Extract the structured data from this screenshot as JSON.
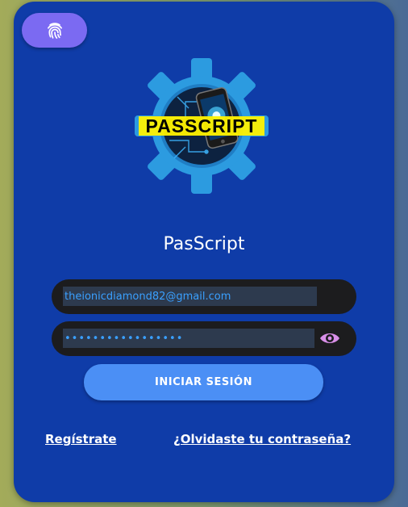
{
  "app": {
    "title": "PasScript",
    "logo_text": "PASSCRIPT"
  },
  "fingerprint_button": {
    "icon": "fingerprint-icon"
  },
  "login_form": {
    "email_value": "theionicdiamond82@gmail.com",
    "password_value": "•••••••••••••••••",
    "toggle_visibility_icon": "eye-icon",
    "submit_label": "INICIAR SESIÓN"
  },
  "links": {
    "register": "Regístrate",
    "forgot_password": "¿Olvidaste tu contraseña?"
  },
  "colors": {
    "card_background": "#0f3ca8",
    "accent_purple": "#7b6af2",
    "button_blue": "#4b8ff5",
    "input_background": "#1c1c1e",
    "eye_icon": "#d98fe8"
  }
}
